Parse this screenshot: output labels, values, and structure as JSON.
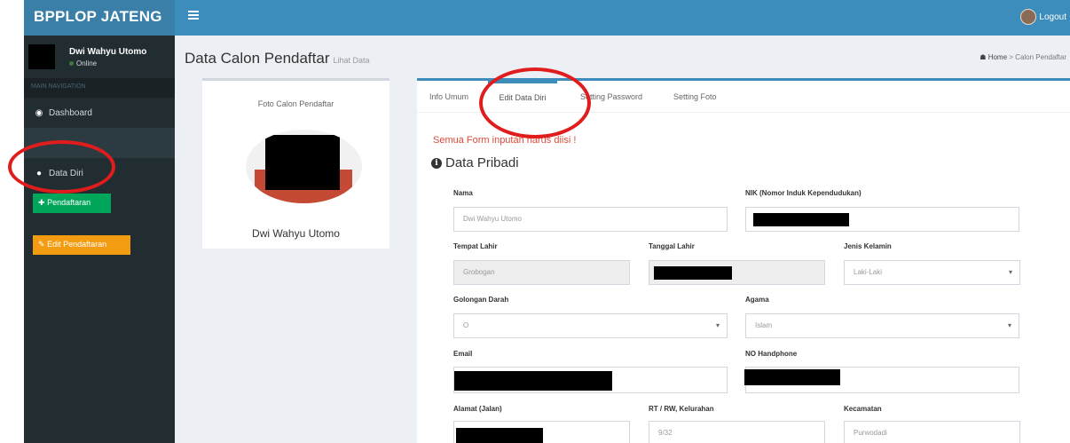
{
  "app": {
    "brand_bold": "BPPLOP",
    "brand_rest": " JATENG"
  },
  "header": {
    "logout_label": "Logout"
  },
  "sidebar": {
    "user_name": "Dwi Wahyu Utomo",
    "user_status": "Online",
    "nav_header": "MAIN NAVIGATION",
    "items": [
      {
        "label": "Dashboard",
        "icon": "dashboard-icon"
      },
      {
        "label": "Data Diri",
        "icon": "user-icon"
      }
    ],
    "btn_pendaftaran": "Pendaftaran",
    "btn_edit": "Edit Pendaftaran"
  },
  "page": {
    "title": "Data Calon Pendaftar",
    "subtitle": "Lihat Data"
  },
  "breadcrumb": {
    "home": "Home",
    "current": "Calon Pendaftar"
  },
  "profile": {
    "photo_label": "Foto Calon Pendaftar",
    "name": "Dwi Wahyu Utomo"
  },
  "tabs": [
    "Info Umum",
    "Edit Data Diri",
    "Setting Password",
    "Setting Foto"
  ],
  "form": {
    "notice": "Semua Form inputan harus diisi !",
    "section_title": "Data Pribadi",
    "nama_label": "Nama",
    "nama_value": "Dwi Wahyu Utomo",
    "nik_label": "NIK (Nomor Induk Kependudukan)",
    "tempat_lahir_label": "Tempat Lahir",
    "tempat_lahir_value": "Grobogan",
    "tanggal_lahir_label": "Tanggal Lahir",
    "jenis_kelamin_label": "Jenis Kelamin",
    "jenis_kelamin_value": "Laki-Laki",
    "golongan_darah_label": "Golongan Darah",
    "golongan_darah_value": "O",
    "agama_label": "Agama",
    "agama_value": "Islam",
    "email_label": "Email",
    "hp_label": "NO Handphone",
    "alamat_label": "Alamat (Jalan)",
    "rtrw_label": "RT / RW, Kelurahan",
    "rtrw_value": "9/32",
    "kecamatan_label": "Kecamatan",
    "kecamatan_value": "Purwodadi"
  },
  "colors": {
    "header": "#3c8dbc",
    "sidebar": "#222d32",
    "annotation": "#e01c1c",
    "notice": "#dd4b39"
  }
}
